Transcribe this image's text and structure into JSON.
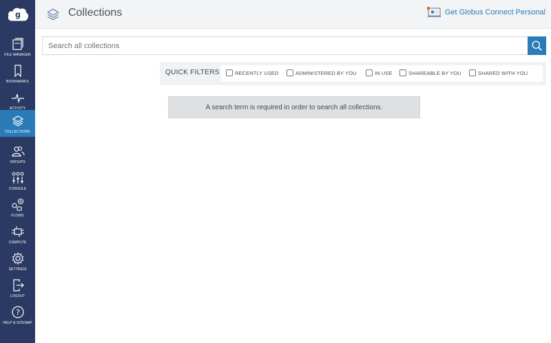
{
  "sidebar": {
    "items": [
      {
        "label": "FILE MANAGER",
        "icon": "file-manager-icon"
      },
      {
        "label": "BOOKMARKS",
        "icon": "bookmark-icon"
      },
      {
        "label": "ACTIVITY",
        "icon": "activity-icon"
      },
      {
        "label": "COLLECTIONS",
        "icon": "collections-icon",
        "active": true
      },
      {
        "label": "GROUPS",
        "icon": "groups-icon"
      },
      {
        "label": "CONSOLE",
        "icon": "console-icon"
      },
      {
        "label": "FLOWS",
        "icon": "flows-icon"
      },
      {
        "label": "COMPUTE",
        "icon": "compute-icon"
      },
      {
        "label": "SETTINGS",
        "icon": "settings-icon"
      },
      {
        "label": "LOGOUT",
        "icon": "logout-icon"
      },
      {
        "label": "HELP & SITEMAP",
        "icon": "help-icon"
      }
    ]
  },
  "header": {
    "title": "Collections",
    "gcp_link": "Get Globus Connect Personal"
  },
  "search": {
    "placeholder": "Search all collections",
    "value": ""
  },
  "quick_filters": {
    "label": "QUICK FILTERS",
    "options": [
      {
        "label": "RECENTLY USED",
        "checked": false
      },
      {
        "label": "ADMINISTERED BY YOU",
        "checked": false
      },
      {
        "label": "IN USE",
        "checked": false
      },
      {
        "label": "SHAREABLE BY YOU",
        "checked": false
      },
      {
        "label": "SHARED WITH YOU",
        "checked": false
      }
    ]
  },
  "message": "A search term is required in order to search all collections.",
  "colors": {
    "sidebar_bg": "#2b3a63",
    "accent": "#2a7bb8",
    "header_bg": "#f3f4f6"
  }
}
